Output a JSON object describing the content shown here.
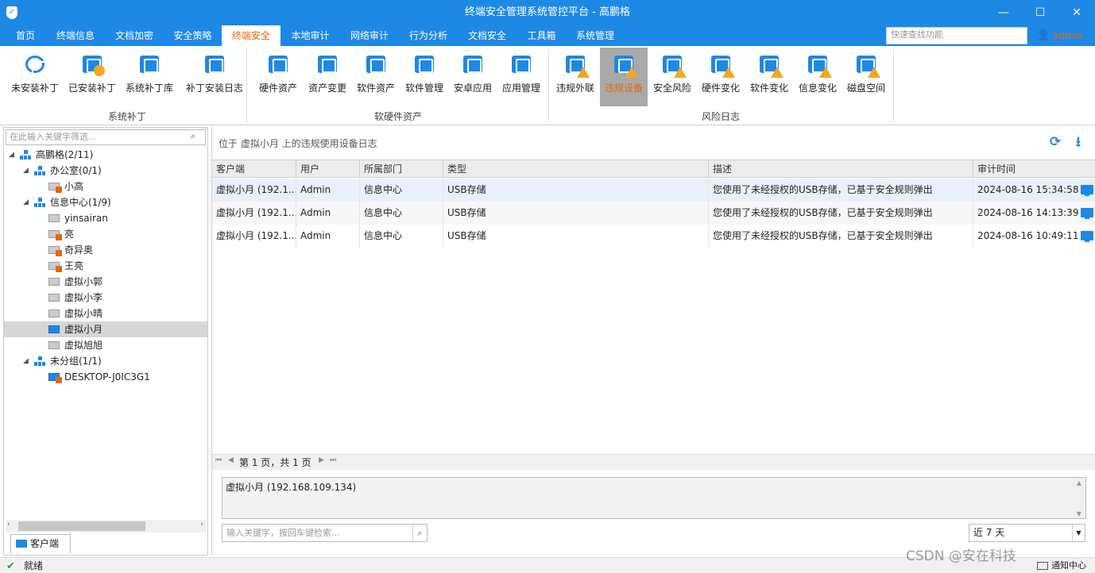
{
  "window": {
    "title": "终端安全管理系统管控平台 - 高鹏格",
    "minimize": "—",
    "maximize": "☐",
    "close": "✕"
  },
  "menu": {
    "tabs": [
      "首页",
      "终端信息",
      "文档加密",
      "安全策略",
      "终端安全",
      "本地审计",
      "网络审计",
      "行为分析",
      "文档安全",
      "工具箱",
      "系统管理"
    ],
    "active_index": 4,
    "search_placeholder": "快速查找功能",
    "user": "admin"
  },
  "ribbon": {
    "groups": [
      {
        "title": "系统补丁",
        "buttons": [
          "未安装补丁",
          "已安装补丁",
          "系统补丁库",
          "补丁安装日志"
        ]
      },
      {
        "title": "软硬件资产",
        "buttons": [
          "硬件资产",
          "资产变更",
          "软件资产",
          "软件管理",
          "安卓应用",
          "应用管理"
        ]
      },
      {
        "title": "风险日志",
        "buttons": [
          "违规外联",
          "违规设备",
          "安全风险",
          "硬件变化",
          "软件变化",
          "信息变化",
          "磁盘空间"
        ]
      }
    ],
    "active_button": "违规设备",
    "accent": "#e8650f",
    "primary": "#1e88e5"
  },
  "tree": {
    "filter_placeholder": "在此输入关键字筛选...",
    "nodes": [
      {
        "label": "高鹏格(2/11)",
        "type": "org"
      },
      {
        "label": "办公室(0/1)",
        "type": "org"
      },
      {
        "label": "小高",
        "type": "pc-locked"
      },
      {
        "label": "信息中心(1/9)",
        "type": "org"
      },
      {
        "label": "yinsairan",
        "type": "pc-offline"
      },
      {
        "label": "亮",
        "type": "pc-locked"
      },
      {
        "label": "奇异奥",
        "type": "pc-locked"
      },
      {
        "label": "王亮",
        "type": "pc-locked"
      },
      {
        "label": "虚拟小郭",
        "type": "pc-offline"
      },
      {
        "label": "虚拟小李",
        "type": "pc-offline"
      },
      {
        "label": "虚拟小晴",
        "type": "pc-offline"
      },
      {
        "label": "虚拟小月",
        "type": "pc-online"
      },
      {
        "label": "虚拟旭旭",
        "type": "pc-offline"
      },
      {
        "label": "未分组(1/1)",
        "type": "org"
      },
      {
        "label": "DESKTOP-J0IC3G1",
        "type": "pc-online-locked"
      }
    ],
    "selected": "虚拟小月",
    "tab_label": "客户端"
  },
  "main": {
    "location_text": "位于 虚拟小月 上的违规使用设备日志",
    "columns": [
      "客户端",
      "用户",
      "所属部门",
      "类型",
      "描述",
      "审计时间"
    ],
    "rows": [
      [
        "虚拟小月 (192.1...",
        "Admin",
        "信息中心",
        "USB存储",
        "您使用了未经授权的USB存储，已基于安全规则弹出",
        "2024-08-16 15:34:58"
      ],
      [
        "虚拟小月 (192.1...",
        "Admin",
        "信息中心",
        "USB存储",
        "您使用了未经授权的USB存储，已基于安全规则弹出",
        "2024-08-16 14:13:39"
      ],
      [
        "虚拟小月 (192.1...",
        "Admin",
        "信息中心",
        "USB存储",
        "您使用了未经授权的USB存储，已基于安全规则弹出",
        "2024-08-16 10:49:11"
      ]
    ],
    "pager_text": "第 1 页，共 1 页",
    "detail_text": "虚拟小月 (192.168.109.134)",
    "search_placeholder": "输入关键字，按回车键检索...",
    "period_value": "近 7 天"
  },
  "status": {
    "text": "就绪",
    "notice": "通知中心",
    "watermark": "CSDN @安在科技"
  }
}
